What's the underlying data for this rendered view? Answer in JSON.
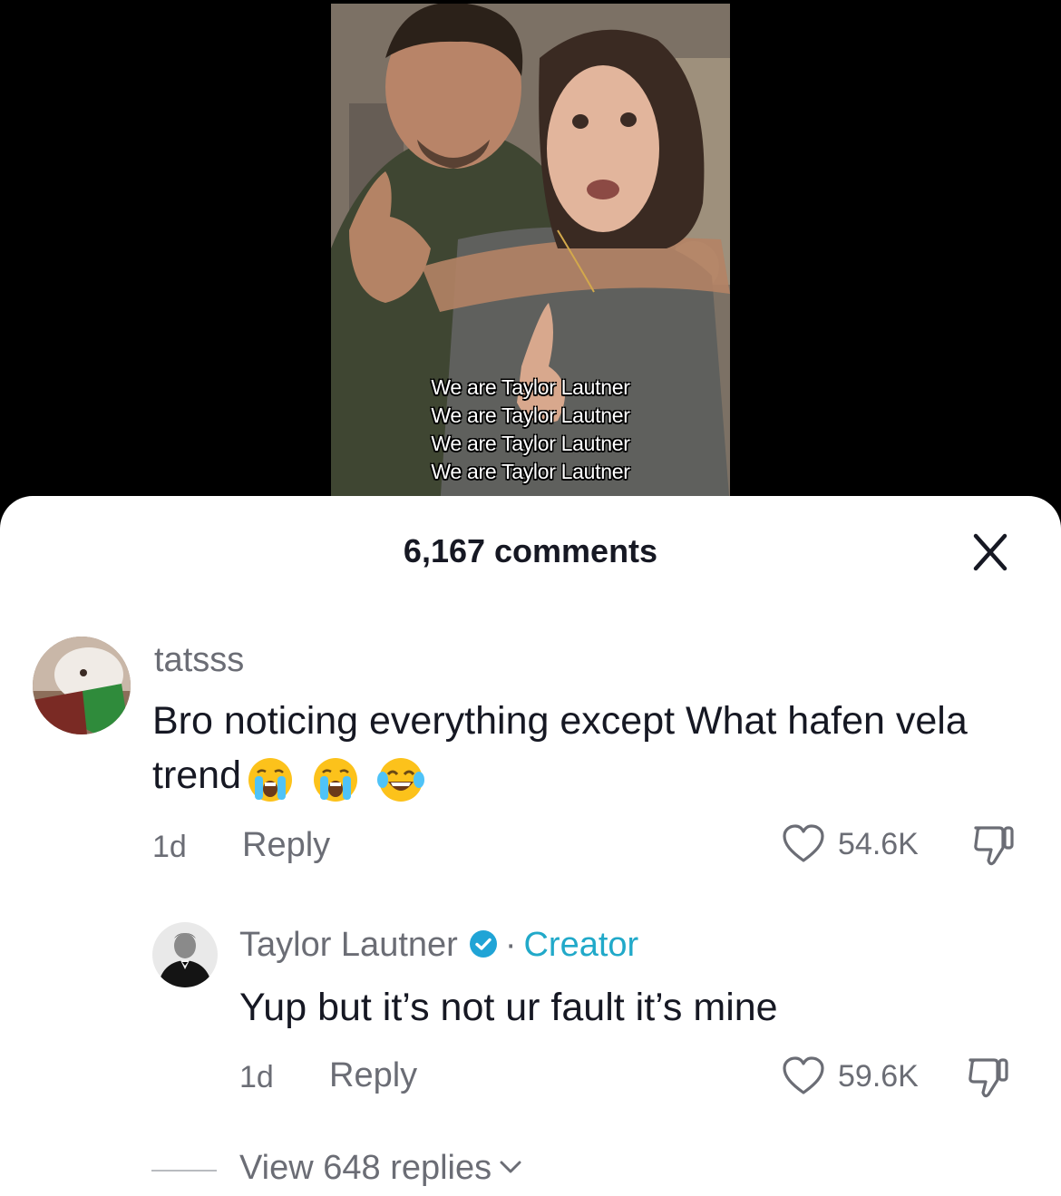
{
  "video": {
    "caption_lines": [
      "We are Taylor Lautner",
      "We are Taylor Lautner",
      "We are Taylor Lautner",
      "We are Taylor Lautner"
    ]
  },
  "comments_sheet": {
    "title": "6,167 comments",
    "close_icon": "close-icon",
    "comments": [
      {
        "username": "tatsss",
        "text": "Bro noticing everything except What hafen vela trend",
        "emojis": [
          "loudly-crying-face",
          "loudly-crying-face",
          "face-with-tears-of-joy"
        ],
        "age": "1d",
        "reply_label": "Reply",
        "like_count": "54.6K"
      },
      {
        "username": "Taylor Lautner",
        "verified": true,
        "separator": "·",
        "badge": "Creator",
        "text": "Yup but it’s not ur fault it’s mine",
        "age": "1d",
        "reply_label": "Reply",
        "like_count": "59.6K"
      }
    ],
    "view_replies_label": "View 648 replies"
  },
  "colors": {
    "text_primary": "#161823",
    "text_secondary": "#6b6d75",
    "creator_accent": "#21a9c9",
    "verified_badge": "#20a4d6"
  }
}
